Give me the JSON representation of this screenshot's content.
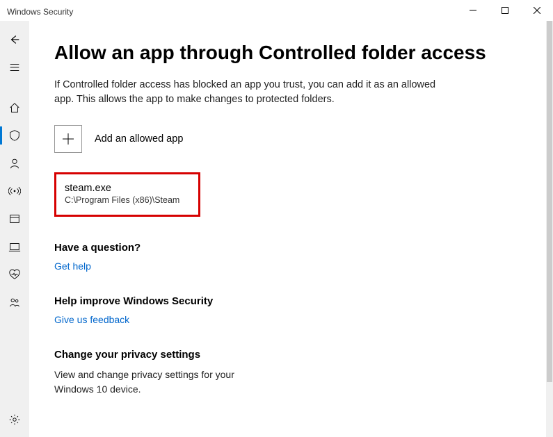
{
  "window": {
    "title": "Windows Security"
  },
  "sidebar": {
    "items": [
      {
        "name": "back"
      },
      {
        "name": "menu"
      },
      {
        "name": "home"
      },
      {
        "name": "shield",
        "active": true
      },
      {
        "name": "person"
      },
      {
        "name": "network"
      },
      {
        "name": "app-browser"
      },
      {
        "name": "device"
      },
      {
        "name": "health"
      },
      {
        "name": "family"
      }
    ],
    "bottom": {
      "name": "settings"
    }
  },
  "page": {
    "title": "Allow an app through Controlled folder access",
    "subtitle": "If Controlled folder access has blocked an app you trust, you can add it as an allowed app. This allows the app to make changes to protected folders.",
    "add": {
      "label": "Add an allowed app"
    },
    "apps": [
      {
        "name": "steam.exe",
        "path": "C:\\Program Files (x86)\\Steam"
      }
    ],
    "help": {
      "heading": "Have a question?",
      "link": "Get help"
    },
    "feedback": {
      "heading": "Help improve Windows Security",
      "link": "Give us feedback"
    },
    "privacy": {
      "heading": "Change your privacy settings",
      "text": "View and change privacy settings for your Windows 10 device."
    }
  }
}
